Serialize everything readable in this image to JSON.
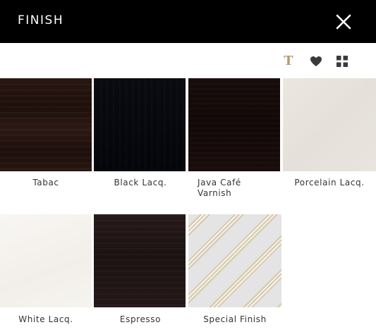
{
  "header": {
    "title": "FINISH",
    "close_icon": "close-icon"
  },
  "toolbar": {
    "text_icon": "text-icon",
    "text_glyph": "T",
    "heart_icon": "heart-icon",
    "grid_icon": "grid-icon",
    "accent_color": "#b89a72"
  },
  "finishes": [
    {
      "label": "Tabac"
    },
    {
      "label": "Black Lacq."
    },
    {
      "label": "Java Café Varnish"
    },
    {
      "label": "Porcelain Lacq."
    },
    {
      "label": "White Lacq."
    },
    {
      "label": "Espresso"
    },
    {
      "label": "Special Finish"
    }
  ]
}
